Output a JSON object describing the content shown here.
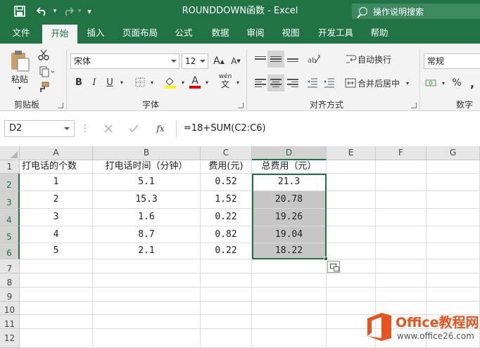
{
  "titlebar": {
    "doc_title": "ROUNDDOWN函数  -  Excel",
    "tell_me": "操作说明搜索"
  },
  "tabs": [
    "文件",
    "开始",
    "插入",
    "页面布局",
    "公式",
    "数据",
    "审阅",
    "视图",
    "开发工具",
    "帮助"
  ],
  "active_tab": "开始",
  "ribbon": {
    "paste_label": "粘贴",
    "clipboard_label": "剪贴板",
    "font_name": "宋体",
    "font_size": "12",
    "font_group_label": "字体",
    "bold": "B",
    "italic": "I",
    "underline": "U",
    "font_color_letter": "A",
    "increase_font": "A",
    "decrease_font": "A",
    "phonetic": "wén",
    "wrap_text": "自动换行",
    "merge_center": "合并后居中",
    "align_group_label": "对齐方式",
    "number_format": "常规",
    "percent": "%",
    "comma": ",",
    "number_group_label": "数字"
  },
  "formula_bar": {
    "name_box": "D2",
    "fx": "fx",
    "formula": "=18+SUM(C2:C6)"
  },
  "grid": {
    "columns": [
      "A",
      "B",
      "C",
      "D",
      "E",
      "F",
      "G"
    ],
    "rows": [
      "1",
      "2",
      "3",
      "4",
      "5",
      "6",
      "7",
      "8",
      "9",
      "10",
      "11",
      "12"
    ],
    "headers": [
      "打电话的个数",
      "打电话时间（分钟）",
      "费用(元)",
      "总费用（元）"
    ],
    "data": [
      [
        "1",
        "5.1",
        "0.52",
        "21.3"
      ],
      [
        "2",
        "15.3",
        "1.52",
        "20.78"
      ],
      [
        "3",
        "1.6",
        "0.22",
        "19.26"
      ],
      [
        "4",
        "8.7",
        "0.82",
        "19.04"
      ],
      [
        "5",
        "2.1",
        "0.22",
        "18.22"
      ]
    ],
    "selected_column": "D",
    "selected_rows": [
      "2",
      "3",
      "4",
      "5",
      "6"
    ]
  },
  "watermark": {
    "brand": "Office教程网",
    "url": "www.office26.com"
  },
  "colors": {
    "accent": "#217346",
    "selection_fill": "#c6c6c6",
    "watermark_orange": "#e8531d"
  }
}
